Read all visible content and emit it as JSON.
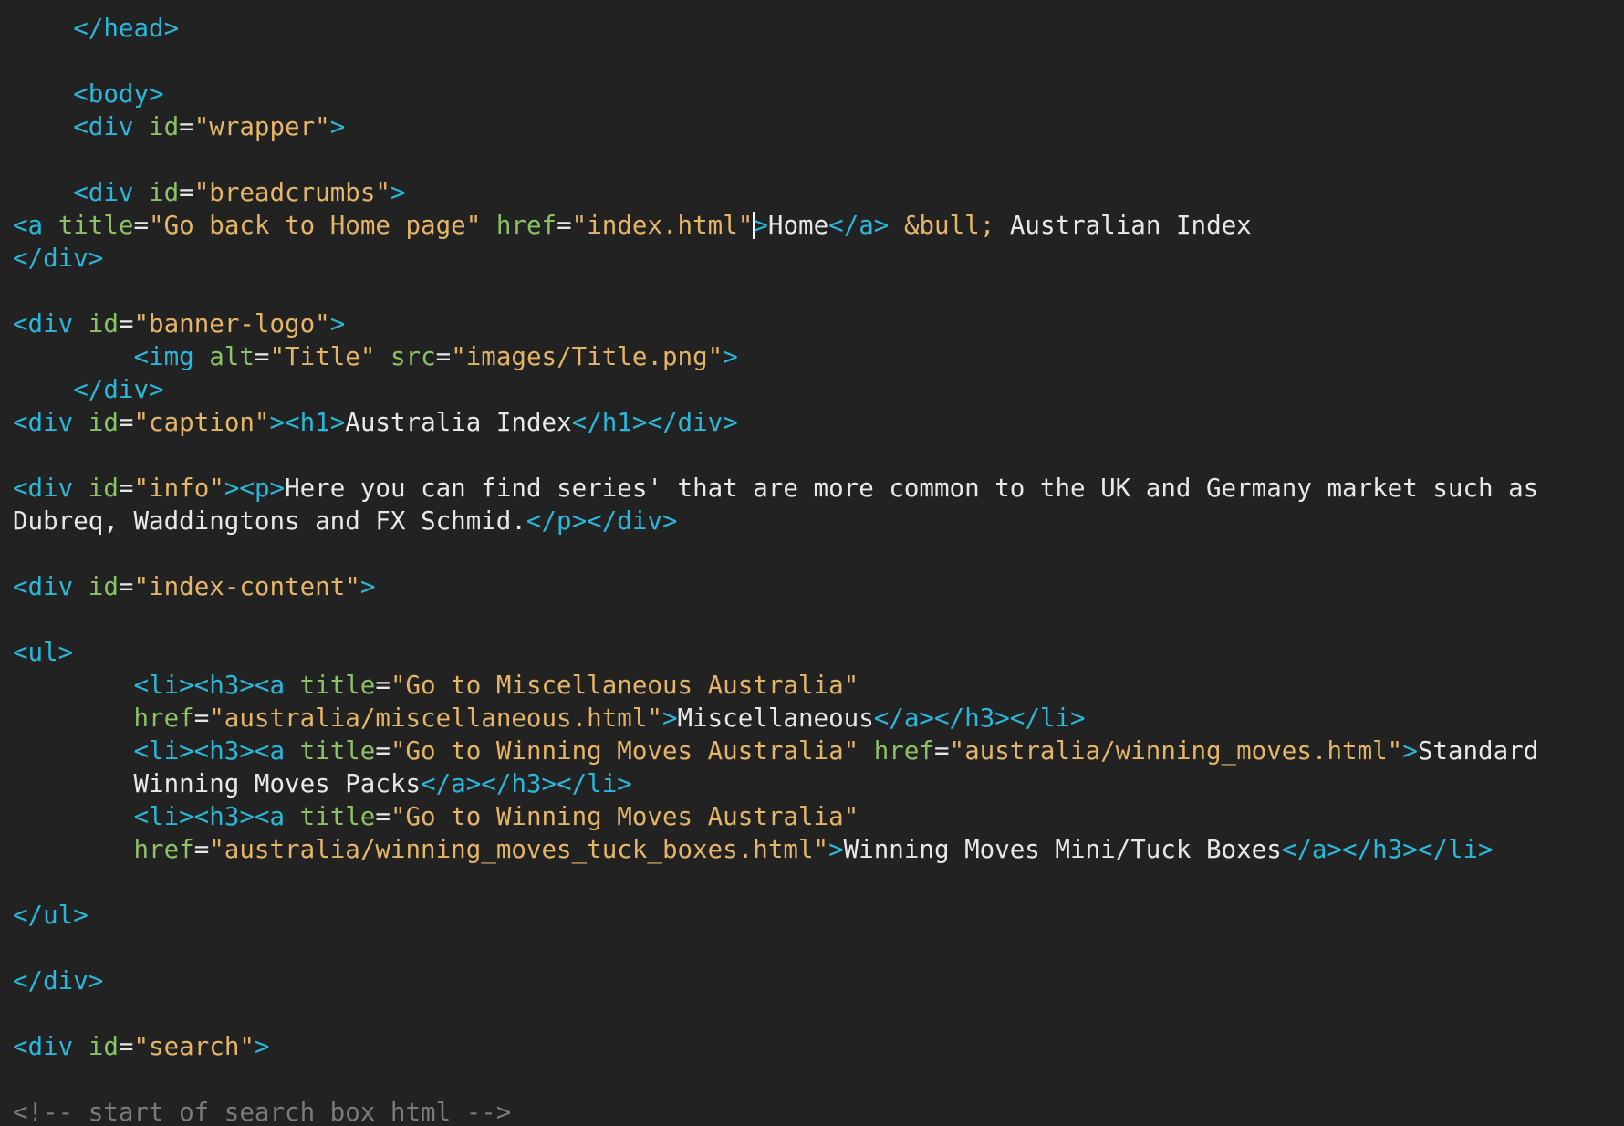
{
  "editor": {
    "theme_colors": {
      "background": "#222222",
      "tag": "#29b8db",
      "attribute": "#8cc265",
      "string": "#e5b567",
      "text": "#e8e8e8",
      "comment": "#7a7a7a"
    },
    "caret": {
      "line": 6,
      "before_token": 9
    },
    "lines": [
      [
        {
          "t": "tag",
          "v": "    </head>"
        }
      ],
      [],
      [
        {
          "t": "tag",
          "v": "    <body>"
        }
      ],
      [
        {
          "t": "tag",
          "v": "    <div"
        },
        {
          "t": "text",
          "v": " "
        },
        {
          "t": "attr",
          "v": "id"
        },
        {
          "t": "punct",
          "v": "="
        },
        {
          "t": "str",
          "v": "\"wrapper\""
        },
        {
          "t": "tag",
          "v": ">"
        }
      ],
      [],
      [
        {
          "t": "tag",
          "v": "    <div"
        },
        {
          "t": "text",
          "v": " "
        },
        {
          "t": "attr",
          "v": "id"
        },
        {
          "t": "punct",
          "v": "="
        },
        {
          "t": "str",
          "v": "\"breadcrumbs\""
        },
        {
          "t": "tag",
          "v": ">"
        }
      ],
      [
        {
          "t": "tag",
          "v": "<a"
        },
        {
          "t": "text",
          "v": " "
        },
        {
          "t": "attr",
          "v": "title"
        },
        {
          "t": "punct",
          "v": "="
        },
        {
          "t": "str",
          "v": "\"Go back to Home page\""
        },
        {
          "t": "text",
          "v": " "
        },
        {
          "t": "attr",
          "v": "href"
        },
        {
          "t": "punct",
          "v": "="
        },
        {
          "t": "str",
          "v": "\"index.html\""
        },
        {
          "t": "tag",
          "v": ">"
        },
        {
          "t": "text",
          "v": "Home"
        },
        {
          "t": "tag",
          "v": "</a>"
        },
        {
          "t": "text",
          "v": " "
        },
        {
          "t": "entity",
          "v": "&bull;"
        },
        {
          "t": "text",
          "v": " Australian Index"
        }
      ],
      [
        {
          "t": "tag",
          "v": "</div>"
        }
      ],
      [],
      [
        {
          "t": "tag",
          "v": "<div"
        },
        {
          "t": "text",
          "v": " "
        },
        {
          "t": "attr",
          "v": "id"
        },
        {
          "t": "punct",
          "v": "="
        },
        {
          "t": "str",
          "v": "\"banner-logo\""
        },
        {
          "t": "tag",
          "v": ">"
        }
      ],
      [
        {
          "t": "tag",
          "v": "        <img"
        },
        {
          "t": "text",
          "v": " "
        },
        {
          "t": "attr",
          "v": "alt"
        },
        {
          "t": "punct",
          "v": "="
        },
        {
          "t": "str",
          "v": "\"Title\""
        },
        {
          "t": "text",
          "v": " "
        },
        {
          "t": "attr",
          "v": "src"
        },
        {
          "t": "punct",
          "v": "="
        },
        {
          "t": "str",
          "v": "\"images/Title.png\""
        },
        {
          "t": "tag",
          "v": ">"
        }
      ],
      [
        {
          "t": "tag",
          "v": "    </div>"
        }
      ],
      [
        {
          "t": "tag",
          "v": "<div"
        },
        {
          "t": "text",
          "v": " "
        },
        {
          "t": "attr",
          "v": "id"
        },
        {
          "t": "punct",
          "v": "="
        },
        {
          "t": "str",
          "v": "\"caption\""
        },
        {
          "t": "tag",
          "v": "><h1>"
        },
        {
          "t": "text",
          "v": "Australia Index"
        },
        {
          "t": "tag",
          "v": "</h1></div>"
        }
      ],
      [],
      [
        {
          "t": "tag",
          "v": "<div"
        },
        {
          "t": "text",
          "v": " "
        },
        {
          "t": "attr",
          "v": "id"
        },
        {
          "t": "punct",
          "v": "="
        },
        {
          "t": "str",
          "v": "\"info\""
        },
        {
          "t": "tag",
          "v": "><p>"
        },
        {
          "t": "text",
          "v": "Here you can find series' that are more common to the UK and Germany market such as"
        }
      ],
      [
        {
          "t": "text",
          "v": "Dubreq, Waddingtons and FX Schmid."
        },
        {
          "t": "tag",
          "v": "</p></div>"
        }
      ],
      [],
      [
        {
          "t": "tag",
          "v": "<div"
        },
        {
          "t": "text",
          "v": " "
        },
        {
          "t": "attr",
          "v": "id"
        },
        {
          "t": "punct",
          "v": "="
        },
        {
          "t": "str",
          "v": "\"index-content\""
        },
        {
          "t": "tag",
          "v": ">"
        }
      ],
      [],
      [
        {
          "t": "tag",
          "v": "<ul>"
        }
      ],
      [
        {
          "t": "tag",
          "v": "        <li><h3><a"
        },
        {
          "t": "text",
          "v": " "
        },
        {
          "t": "attr",
          "v": "title"
        },
        {
          "t": "punct",
          "v": "="
        },
        {
          "t": "str",
          "v": "\"Go to Miscellaneous Australia\""
        }
      ],
      [
        {
          "t": "text",
          "v": "        "
        },
        {
          "t": "attr",
          "v": "href"
        },
        {
          "t": "punct",
          "v": "="
        },
        {
          "t": "str",
          "v": "\"australia/miscellaneous.html\""
        },
        {
          "t": "tag",
          "v": ">"
        },
        {
          "t": "text",
          "v": "Miscellaneous"
        },
        {
          "t": "tag",
          "v": "</a></h3></li>"
        }
      ],
      [
        {
          "t": "tag",
          "v": "        <li><h3><a"
        },
        {
          "t": "text",
          "v": " "
        },
        {
          "t": "attr",
          "v": "title"
        },
        {
          "t": "punct",
          "v": "="
        },
        {
          "t": "str",
          "v": "\"Go to Winning Moves Australia\""
        },
        {
          "t": "text",
          "v": " "
        },
        {
          "t": "attr",
          "v": "href"
        },
        {
          "t": "punct",
          "v": "="
        },
        {
          "t": "str",
          "v": "\"australia/winning_moves.html\""
        },
        {
          "t": "tag",
          "v": ">"
        },
        {
          "t": "text",
          "v": "Standard"
        }
      ],
      [
        {
          "t": "text",
          "v": "        Winning Moves Packs"
        },
        {
          "t": "tag",
          "v": "</a></h3></li>"
        }
      ],
      [
        {
          "t": "tag",
          "v": "        <li><h3><a"
        },
        {
          "t": "text",
          "v": " "
        },
        {
          "t": "attr",
          "v": "title"
        },
        {
          "t": "punct",
          "v": "="
        },
        {
          "t": "str",
          "v": "\"Go to Winning Moves Australia\""
        }
      ],
      [
        {
          "t": "text",
          "v": "        "
        },
        {
          "t": "attr",
          "v": "href"
        },
        {
          "t": "punct",
          "v": "="
        },
        {
          "t": "str",
          "v": "\"australia/winning_moves_tuck_boxes.html\""
        },
        {
          "t": "tag",
          "v": ">"
        },
        {
          "t": "text",
          "v": "Winning Moves Mini/Tuck Boxes"
        },
        {
          "t": "tag",
          "v": "</a></h3></li>"
        }
      ],
      [],
      [
        {
          "t": "tag",
          "v": "</ul>"
        }
      ],
      [],
      [
        {
          "t": "tag",
          "v": "</div>"
        }
      ],
      [],
      [
        {
          "t": "tag",
          "v": "<div"
        },
        {
          "t": "text",
          "v": " "
        },
        {
          "t": "attr",
          "v": "id"
        },
        {
          "t": "punct",
          "v": "="
        },
        {
          "t": "str",
          "v": "\"search\""
        },
        {
          "t": "tag",
          "v": ">"
        }
      ],
      [],
      [
        {
          "t": "comment",
          "v": "<!-- start of search box html -->"
        }
      ]
    ]
  }
}
